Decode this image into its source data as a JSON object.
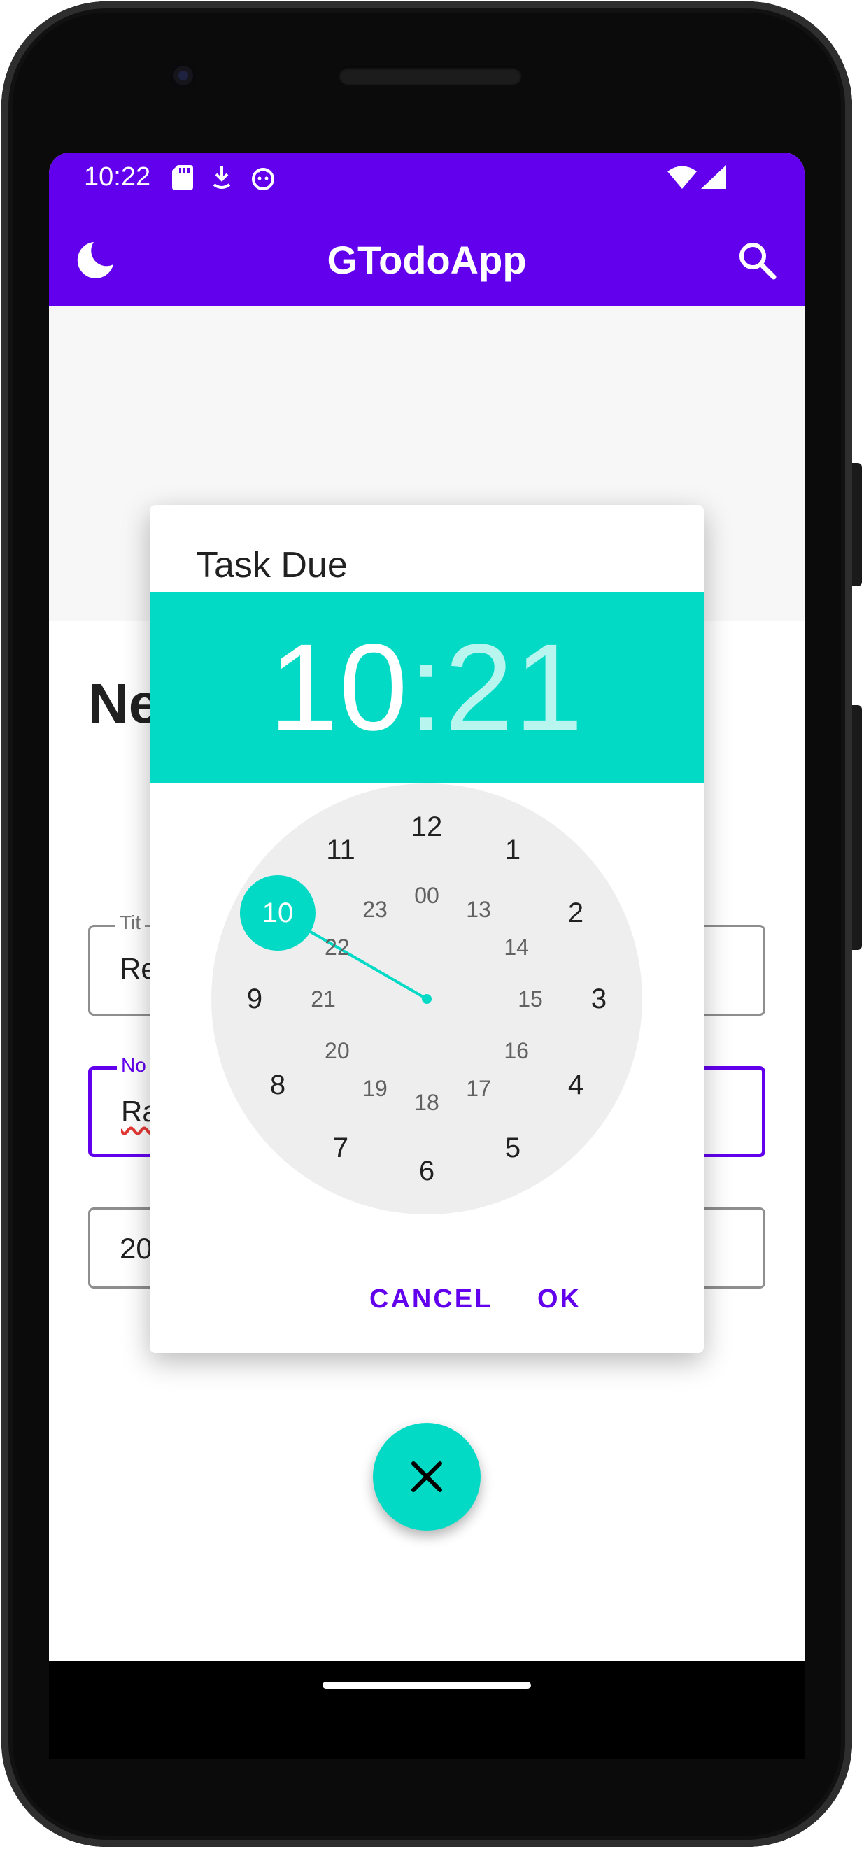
{
  "status_bar": {
    "time": "10:22",
    "icons_left": [
      "sd-card-icon",
      "download-icon",
      "android-debug-icon"
    ],
    "icons_right": [
      "wifi-icon",
      "signal-icon"
    ]
  },
  "app_bar": {
    "title": "GTodoApp",
    "left_icon": "moon-icon",
    "right_icon": "search-icon",
    "color": "#6200ee"
  },
  "form": {
    "heading": "Ne",
    "title_label": "Tit",
    "title_value": "Re",
    "note_label": "No",
    "note_value": "Ra",
    "date_value": "20"
  },
  "dialog": {
    "title": "Task Due",
    "hour": "10",
    "separator": ":",
    "minute": "21",
    "accent_color": "#03dac5",
    "selected_hour": "10",
    "outer_hours": [
      "12",
      "1",
      "2",
      "3",
      "4",
      "5",
      "6",
      "7",
      "8",
      "9",
      "10",
      "11"
    ],
    "inner_hours": [
      "00",
      "13",
      "14",
      "15",
      "16",
      "17",
      "18",
      "19",
      "20",
      "21",
      "22",
      "23"
    ],
    "cancel_label": "CANCEL",
    "ok_label": "OK"
  },
  "fab": {
    "icon": "close-icon"
  }
}
